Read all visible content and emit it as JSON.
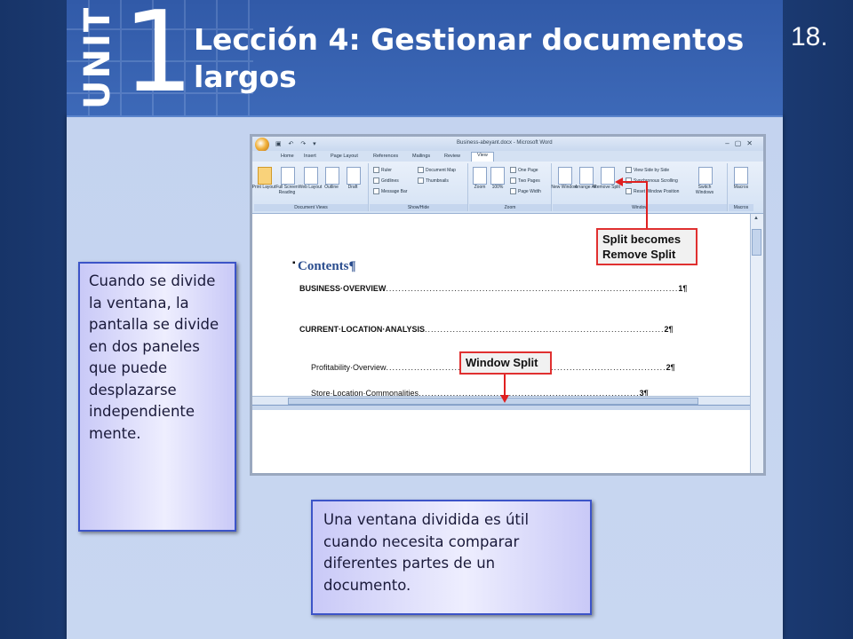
{
  "slide": {
    "unit_word": "UNIT",
    "unit_number": "1",
    "title": "Lección 4: Gestionar documentos largos",
    "slide_number": "18."
  },
  "callouts": {
    "left_text": "Cuando se divide la ventana, la pantalla se divide en dos paneles que puede desplazarse independiente mente.",
    "bottom_text": "Una ventana dividida es útil cuando necesita comparar diferentes partes de un documento."
  },
  "screenshot": {
    "window_title": "Business-abeyant.docx - Microsoft Word",
    "tabs": [
      "Home",
      "Insert",
      "Page Layout",
      "References",
      "Mailings",
      "Review",
      "View"
    ],
    "ribbon": {
      "document_views": {
        "label": "Document Views",
        "buttons": [
          "Print Layout",
          "Full Screen Reading",
          "Web Layout",
          "Outline",
          "Draft"
        ]
      },
      "show_hide": {
        "label": "Show/Hide",
        "checkboxes": [
          "Ruler",
          "Gridlines",
          "Message Bar",
          "Document Map",
          "Thumbnails"
        ]
      },
      "zoom": {
        "label": "Zoom",
        "buttons": [
          "Zoom",
          "100%",
          "One Page",
          "Two Pages",
          "Page Width"
        ]
      },
      "window": {
        "label": "Window",
        "buttons": [
          "New Window",
          "Arrange All",
          "Remove Split",
          "View Side by Side",
          "Synchronous Scrolling",
          "Reset Window Position",
          "Switch Windows"
        ]
      },
      "macros": {
        "label": "Macros",
        "buttons": [
          "Macros"
        ]
      }
    },
    "document": {
      "heading": "Contents¶",
      "toc": [
        {
          "text": "BUSINESS·OVERVIEW",
          "page": "1¶"
        },
        {
          "text": "CURRENT·LOCATION·ANALYSIS",
          "page": "2¶"
        },
        {
          "text": "Profitability·Overview",
          "page": "2¶"
        },
        {
          "text": "Store·Location·Commonalities",
          "page": "3¶"
        }
      ]
    },
    "annotations": {
      "remove_split": "Split becomes Remove Split",
      "window_split": "Window Split"
    }
  },
  "colors": {
    "header_blue": "#315aa8",
    "panel_bg": "#c4d3ef",
    "callout_border": "#3c54c8",
    "annotation_red": "#e03030"
  }
}
